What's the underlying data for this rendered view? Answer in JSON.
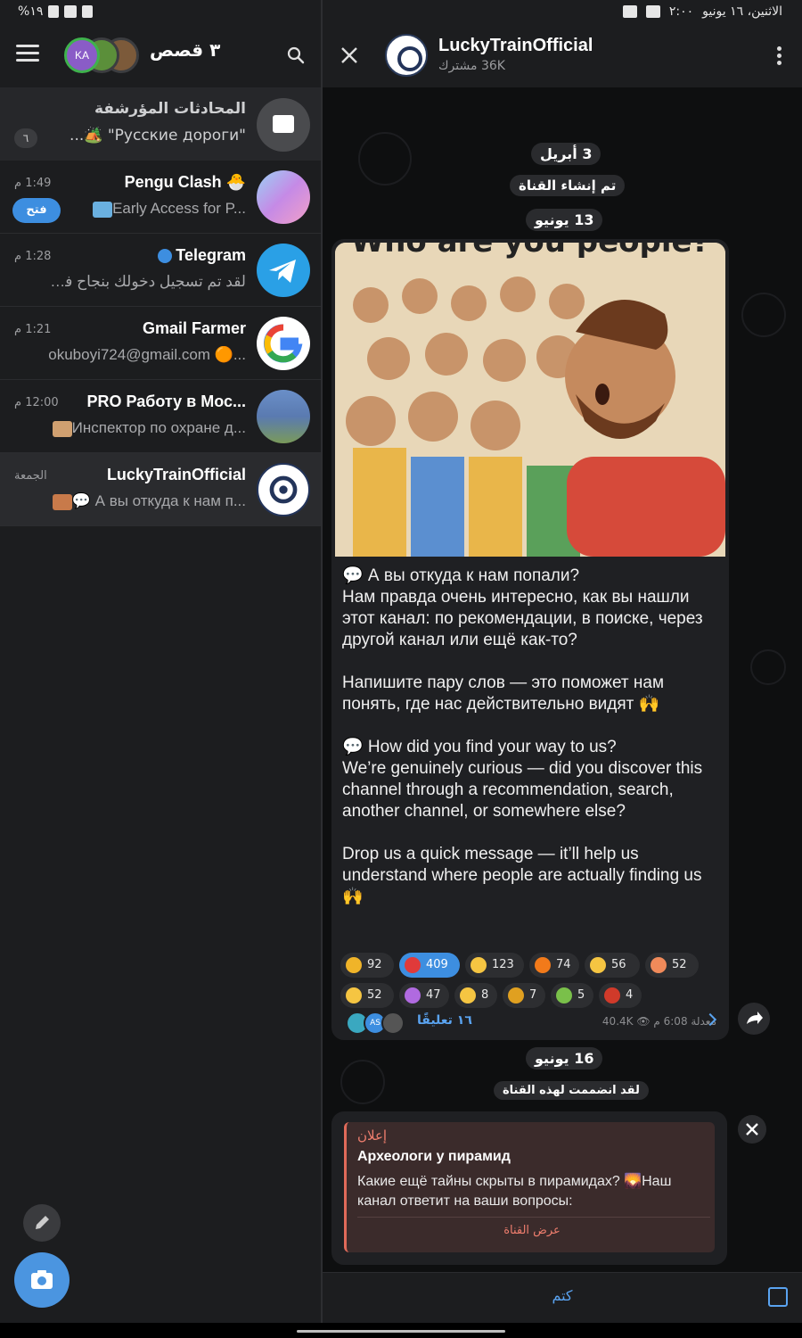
{
  "status_bar": {
    "left": "%١٩",
    "right_time": "٢:٠٠",
    "right_date": "الاثنين، ١٦ يونيو"
  },
  "left_panel": {
    "stories_label": "٣ قصص",
    "story_initials": "KA",
    "archived": {
      "title": "المحادثات المؤرشفة",
      "subtitle": "\"Русские дороги\" 🏕️...",
      "badge": "٦"
    },
    "chats": [
      {
        "name": "Pengu Clash 🐣",
        "preview": "Early Access for P...",
        "time": "1:49 م",
        "action": "فتح",
        "avatar_color": "#7a6be0"
      },
      {
        "name": "Telegram",
        "preview": "لقد تم تسجيل دخولك بنجاح في b...",
        "time": "1:28 م",
        "avatar_color": "#2aa0e6"
      },
      {
        "name": "Gmail Farmer",
        "preview": "okuboyi724@gmail.com 🟠...",
        "time": "1:21 م",
        "avatar_color": "#ffffff"
      },
      {
        "name": "PRO Работу в Мос...",
        "preview": "Инспектор по охране д...",
        "time": "12:00 م",
        "avatar_color": "#5a7ab0"
      },
      {
        "name": "LuckyTrainOfficial",
        "preview": "💬 А вы откуда к нам п...",
        "time": "الجمعة",
        "avatar_color": "#ffffff"
      }
    ]
  },
  "channel": {
    "title": "LuckyTrainOfficial",
    "subscribers": "36K مشترك",
    "date_pill_1": "3 أبريل",
    "service_1": "تم إنشاء القناة",
    "date_pill_2": "13 يونيو",
    "image_caption": "Who are you people?",
    "post_text": "💬 А вы откуда к нам попали?\nНам правда очень интересно, как вы нашли этот канал: по рекомендации, в поиске, через другой канал или ещё как-то?\n\nНапишите пару слов — это поможет нам понять, где нас действительно видят 🙌\n\n💬 How did you find your way to us?\nWe’re genuinely curious — did you discover this channel through a recommendation, search, another channel, or somewhere else?\n\nDrop us a quick message — it’ll help us understand where people are actually finding us 🙌",
    "reactions": [
      {
        "emoji": "⭐",
        "count": "92",
        "color": "#f0b429"
      },
      {
        "emoji": "❤️",
        "count": "409",
        "color": "#e03a3a",
        "highlight": true
      },
      {
        "emoji": "👍",
        "count": "123",
        "color": "#f5c542"
      },
      {
        "emoji": "🔥",
        "count": "74",
        "color": "#f27a1a"
      },
      {
        "emoji": "👏",
        "count": "56",
        "color": "#f5c542"
      },
      {
        "emoji": "🥰",
        "count": "52",
        "color": "#f08a5a"
      },
      {
        "emoji": "🤩",
        "count": "52",
        "color": "#f5c542"
      },
      {
        "emoji": "🎉",
        "count": "47",
        "color": "#b06ae0"
      },
      {
        "emoji": "👎",
        "count": "8",
        "color": "#f5c542"
      },
      {
        "emoji": "🏆",
        "count": "7",
        "color": "#e0a020"
      },
      {
        "emoji": "🤮",
        "count": "5",
        "color": "#7ac04a"
      },
      {
        "emoji": "🤬",
        "count": "4",
        "color": "#d03a2a"
      }
    ],
    "post_meta": "معدلة 6:08 م  👁 40.4K",
    "comments_label": "١٦ تعليقًا",
    "comment_avatar_initials": "AS",
    "date_pill_3": "16 يونيو",
    "service_2": "لقد انضممت لهذه القناة",
    "ad": {
      "tag": "إعلان",
      "title": "Археологи у пирамид",
      "body": "Какие ещё тайны скрыты в пирамидах? 🌄Наш канал ответит на ваши вопросы:",
      "button": "عرض القناة"
    },
    "footer_action": "كتم"
  },
  "colors": {
    "accent": "#3d8ee0",
    "link": "#5aa3f0",
    "ad_accent": "#ef7e6e"
  }
}
